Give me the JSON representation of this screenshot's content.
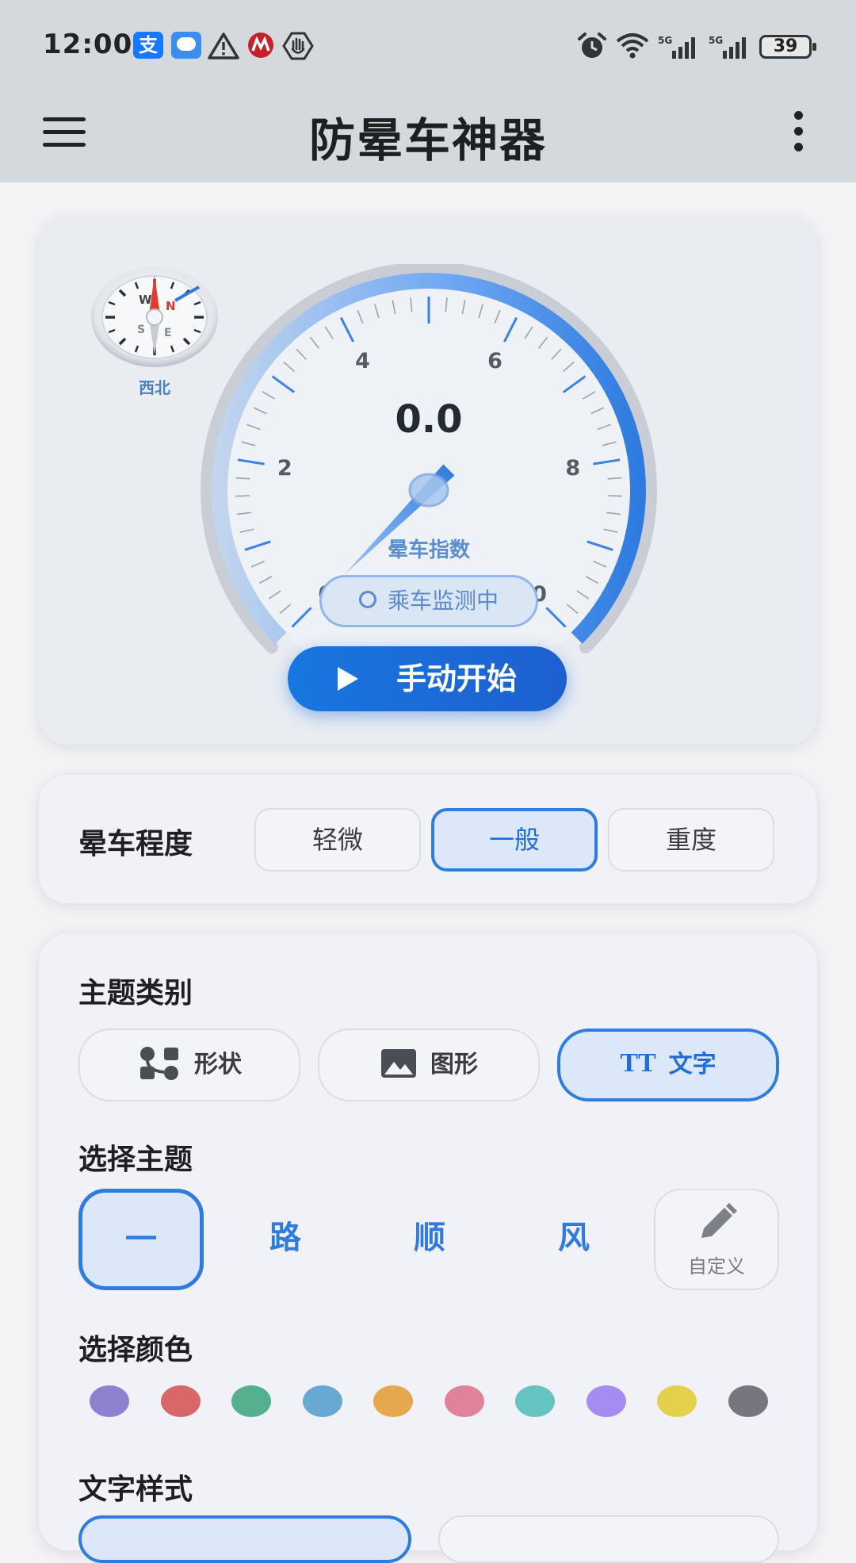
{
  "status_bar": {
    "time": "12:00",
    "alipay_glyph": "支",
    "battery": "39",
    "icons": [
      "alipay-icon",
      "message-icon",
      "warning-icon",
      "bank-icon",
      "hand-icon",
      "alarm-icon",
      "wifi-icon",
      "signal-5g-icon",
      "signal-5g-icon",
      "battery-icon"
    ]
  },
  "app_bar": {
    "title": "防晕车神器",
    "icons": [
      "menu-icon",
      "more-vert-icon"
    ]
  },
  "gauge_card": {
    "compass_N": "N",
    "compass_S": "S",
    "compass_E": "E",
    "compass_W": "W",
    "compass_direction": "西北",
    "value": "0.0",
    "needle_value": 0,
    "min": 0,
    "max": 10,
    "tick_labels": [
      "0",
      "2",
      "4",
      "6",
      "8",
      "10"
    ],
    "label": "晕车指数",
    "status": "乘车监测中",
    "start_button": "手动开始",
    "accent": "#2f7be0"
  },
  "level_card": {
    "title": "晕车程度",
    "options": [
      "轻微",
      "一般",
      "重度"
    ],
    "selected": "一般"
  },
  "theme_card": {
    "category_title": "主题类别",
    "categories": [
      "形状",
      "图形",
      "文字"
    ],
    "selected_category": "文字",
    "theme_title": "选择主题",
    "themes": [
      "一",
      "路",
      "顺",
      "风"
    ],
    "selected_theme": "一",
    "custom_label": "自定义",
    "color_title": "选择颜色",
    "colors": [
      "#8f80d0",
      "#d96767",
      "#55b08f",
      "#67a9d0",
      "#e5a84c",
      "#df8398",
      "#66c4bf",
      "#a58cf3",
      "#e4d04a",
      "#76767f"
    ],
    "text_style_title": "文字样式"
  }
}
